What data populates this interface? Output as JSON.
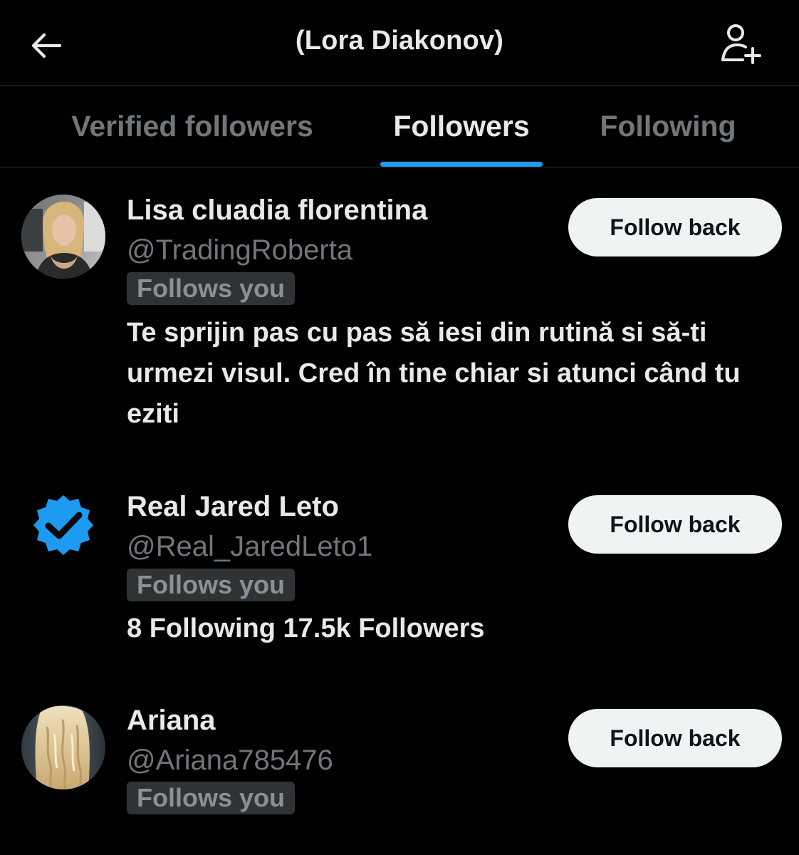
{
  "header": {
    "title": "(Lora Diakonov)",
    "back_icon": "arrow-left-icon",
    "add_icon": "add-user-icon"
  },
  "tabs": [
    {
      "label": "Verified followers",
      "active": false
    },
    {
      "label": "Followers",
      "active": true
    },
    {
      "label": "Following",
      "active": false
    }
  ],
  "accent_color": "#1d9bf0",
  "followers": [
    {
      "name": "Lisa cluadia florentina",
      "handle": "@TradingRoberta",
      "badge": "Follows you",
      "bio": "Te sprijin pas cu pas să iesi din rutină si să-ti urmezi visul. Cred în tine chiar si atunci când tu eziti",
      "button": "Follow back",
      "avatar": "photo-blonde-woman"
    },
    {
      "name": "Real Jared Leto",
      "handle": "@Real_JaredLeto1",
      "badge": "Follows you",
      "bio": "8 Following 17.5k Followers",
      "button": "Follow back",
      "avatar": "verified-badge-icon"
    },
    {
      "name": "Ariana",
      "handle": "@Ariana785476",
      "badge": "Follows you",
      "button": "Follow back",
      "avatar": "photo-blonde-wavy-hair"
    }
  ]
}
